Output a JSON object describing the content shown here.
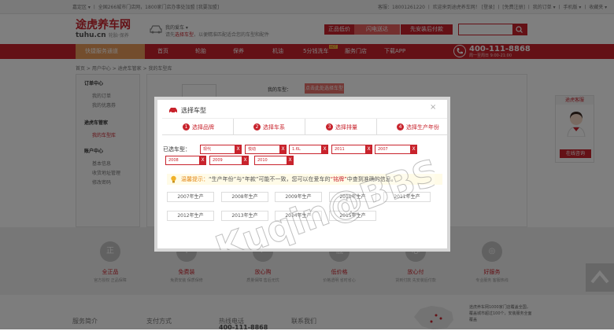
{
  "topbar": {
    "left": "嘉定区 ▾ 丨 全国266城市门店网，1800家门店办事处加盟 [我要加盟]",
    "right_prefix": "客服：18001261220 丨 欢迎来到途虎养车网！",
    "right_links": "[登录] 丨 [免费注册] 丨 我的订单 ▾ 丨 手机版 ▾ 丨 收藏夹 ▾",
    "login": "[登录]",
    "register": "[免费注册]"
  },
  "logo": {
    "name": "途虎养车网",
    "domain": "tuhu.cn",
    "slogan": "轮胎·保养"
  },
  "car_select": {
    "title": "我的爱车 ▾",
    "line": "请先",
    "link": "选择车型",
    "line2": "，以便精准匹配适合您的车型和配件"
  },
  "header_buttons": [
    "正品低价",
    "闪电送达",
    "先安装后付款"
  ],
  "nav": {
    "quick": "快捷服务通道",
    "items": [
      "首页",
      "轮胎",
      "保养",
      "机油",
      "5分钱洗车",
      "服务门店",
      "下载APP"
    ],
    "hot": "HOT",
    "phone": "400-111-8868",
    "phone_sub": "周一至周日 9:00-21:00"
  },
  "breadcrumb": "首页 > 用户中心 > 途虎车管家 > 我的车型库",
  "sidebar": {
    "sections": [
      {
        "title": "订单中心",
        "links": [
          "我的订单",
          "我的优惠券"
        ]
      },
      {
        "title": "途虎车管家",
        "links": [
          "我的车型库"
        ]
      },
      {
        "title": "账户中心",
        "links": [
          "基本信息",
          "收货地址管理",
          "修改密码"
        ]
      }
    ]
  },
  "main": {
    "label": "我的车型：",
    "select_button": "点击此处选择车型"
  },
  "service": {
    "title": "途虎客服",
    "button": "在线咨询"
  },
  "features": [
    {
      "icon": "正",
      "title": "全正品",
      "sub": "官方授权 正品保障"
    },
    {
      "icon": "¥",
      "title": "免费装",
      "sub": "免费安装 保质保修"
    },
    {
      "icon": "✓",
      "title": "放心购",
      "sub": "质量保障 售后无忧"
    },
    {
      "icon": "低",
      "title": "低价格",
      "sub": "价格透明 省时省心"
    },
    {
      "icon": "心",
      "title": "放心付",
      "sub": "货到付款 先安装后付款"
    },
    {
      "icon": "◎",
      "title": "好服务",
      "sub": "专业服务 客服热线"
    }
  ],
  "footer": {
    "headings": [
      "服务简介",
      "支付方式",
      "热线电话",
      "联系我们"
    ],
    "phone": "400-111-8868",
    "text": "途虎养车网1000家门店覆盖全国，覆盖城市超过100个，安装服务全面覆盖"
  },
  "dialog": {
    "title": "选择车型",
    "close": "×",
    "steps": [
      {
        "num": "1",
        "label": "选择品牌"
      },
      {
        "num": "2",
        "label": "选择车系"
      },
      {
        "num": "3",
        "label": "选择排量"
      },
      {
        "num": "4",
        "label": "选择生产年份"
      }
    ],
    "selected_label": "已选车型：",
    "selected_tags": [
      "现代",
      "悦动",
      "1.6L",
      "2011",
      "2007",
      "2008",
      "2009",
      "2010"
    ],
    "remove": "X",
    "tip_label": "温馨提示：",
    "tip_part1": "“生产年份”与“年款”可能不一致，您可以在爱车的",
    "tip_highlight": "“铭牌”",
    "tip_part2": "中查到准确的信息。",
    "years": [
      "2007年生产",
      "2008年生产",
      "2009年生产",
      "2010年生产",
      "2011年生产",
      "2012年生产",
      "2013年生产",
      "2014年生产",
      "2015年生产"
    ]
  },
  "watermark": "Kuqin@BBS"
}
